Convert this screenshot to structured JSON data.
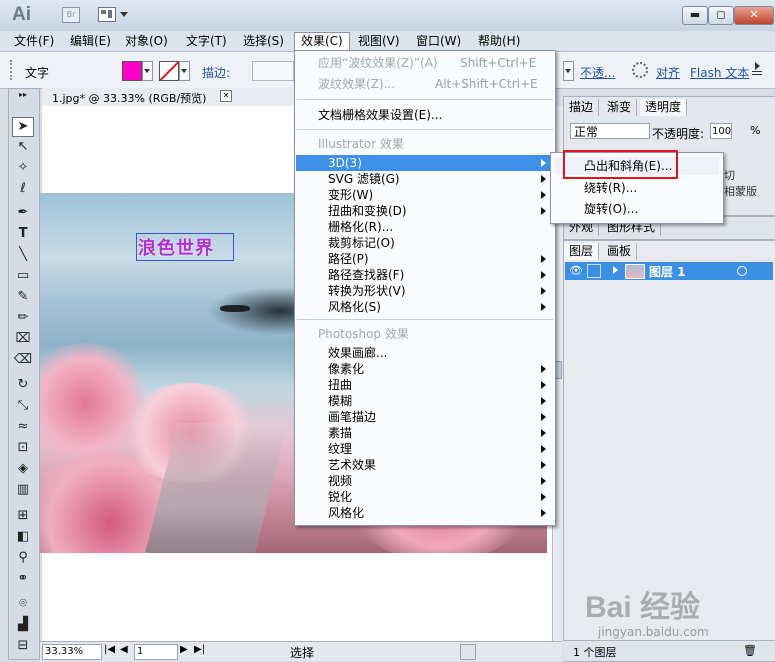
{
  "app": {
    "logo": "Ai",
    "bridge": "Br"
  },
  "window": {
    "minimize": "▬",
    "maximize": "◻",
    "close": "✕"
  },
  "menubar": [
    "文件(F)",
    "编辑(E)",
    "对象(O)",
    "文字(T)",
    "选择(S)",
    "效果(C)",
    "视图(V)",
    "窗口(W)",
    "帮助(H)"
  ],
  "control": {
    "mode": "文字",
    "fill_color": "#ff00cc",
    "stroke_label": "描边:",
    "opacity_label": "不透...",
    "align_label": "对齐",
    "flash_label": "Flash 文本"
  },
  "document": {
    "tab_title": "1.jpg* @ 33.33% (RGB/预览)",
    "tab_close": "✕",
    "canvas_text": "浪色世界",
    "zoom": "33.33%",
    "page": "1",
    "status": "选择"
  },
  "panel_top": {
    "tabs": [
      "描边",
      "渐变",
      "透明度"
    ],
    "blend_mode": "正常",
    "opacity_label": "不透明度:",
    "opacity_value": "100",
    "opacity_unit": "%",
    "partial_text_1": "切",
    "partial_text_2": "相蒙版"
  },
  "panel_mid": {
    "tabs": [
      "外观",
      "图形样式"
    ]
  },
  "layers": {
    "tabs": [
      "图层",
      "画板"
    ],
    "row_name": "图层 1",
    "count": "1 个图层"
  },
  "effect_menu": {
    "apply_last": "应用“波纹效果(Z)”(A)",
    "apply_last_shortcut": "Shift+Ctrl+E",
    "last_effect": "波纹效果(Z)...",
    "last_effect_shortcut": "Alt+Shift+Ctrl+E",
    "raster_settings": "文档栅格效果设置(E)...",
    "illustrator_section": "Illustrator 效果",
    "illustrator_items": [
      {
        "label": "3D(3)",
        "submenu": true
      },
      {
        "label": "SVG 滤镜(G)",
        "submenu": true
      },
      {
        "label": "变形(W)",
        "submenu": true
      },
      {
        "label": "扭曲和变换(D)",
        "submenu": true
      },
      {
        "label": "栅格化(R)...",
        "submenu": false
      },
      {
        "label": "裁剪标记(O)",
        "submenu": false
      },
      {
        "label": "路径(P)",
        "submenu": true
      },
      {
        "label": "路径查找器(F)",
        "submenu": true
      },
      {
        "label": "转换为形状(V)",
        "submenu": true
      },
      {
        "label": "风格化(S)",
        "submenu": true
      }
    ],
    "photoshop_section": "Photoshop 效果",
    "photoshop_items": [
      {
        "label": "效果画廊...",
        "submenu": false
      },
      {
        "label": "像素化",
        "submenu": true
      },
      {
        "label": "扭曲",
        "submenu": true
      },
      {
        "label": "模糊",
        "submenu": true
      },
      {
        "label": "画笔描边",
        "submenu": true
      },
      {
        "label": "素描",
        "submenu": true
      },
      {
        "label": "纹理",
        "submenu": true
      },
      {
        "label": "艺术效果",
        "submenu": true
      },
      {
        "label": "视频",
        "submenu": true
      },
      {
        "label": "锐化",
        "submenu": true
      },
      {
        "label": "风格化",
        "submenu": true
      }
    ]
  },
  "submenu_3d": [
    "凸出和斜角(E)...",
    "绕转(R)...",
    "旋转(O)..."
  ],
  "watermark": {
    "brand": "Bai 经验",
    "url": "jingyan.baidu.com"
  },
  "colors": {
    "highlight": "#3d8fe8",
    "annotation": "#e0151b",
    "fill": "#ff00cc"
  }
}
